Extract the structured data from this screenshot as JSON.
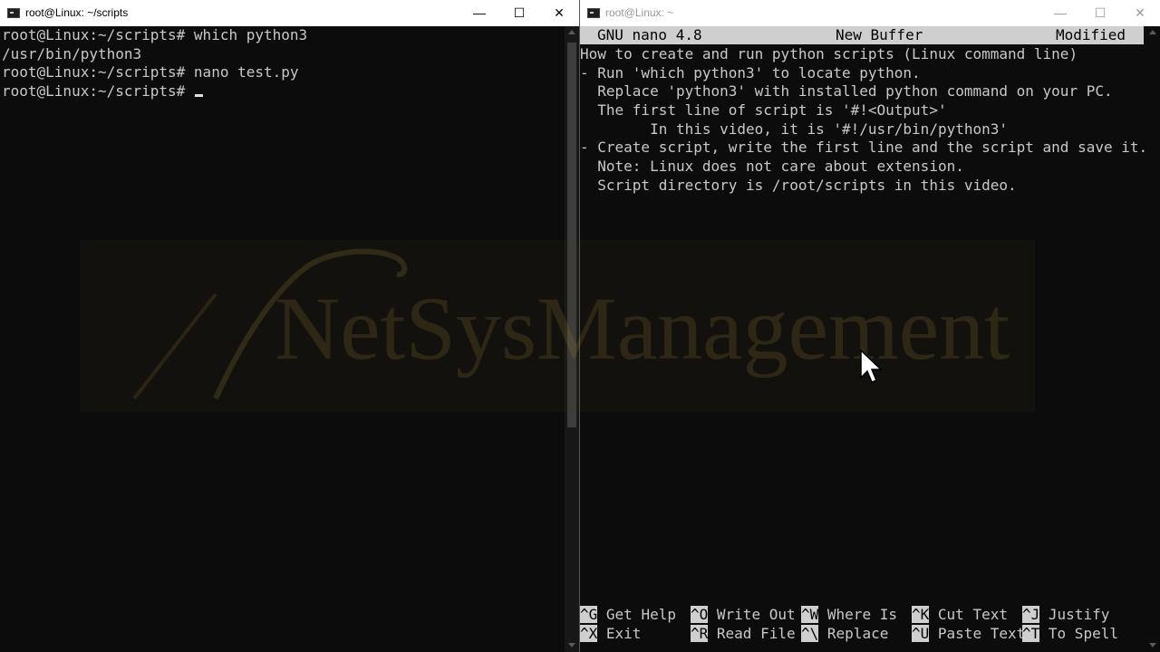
{
  "left_window": {
    "title": "root@Linux: ~/scripts",
    "controls": {
      "minimize": "—",
      "maximize": "☐",
      "close": "✕"
    },
    "lines": [
      "root@Linux:~/scripts# which python3",
      "/usr/bin/python3",
      "root@Linux:~/scripts# nano test.py",
      "root@Linux:~/scripts# "
    ]
  },
  "right_window": {
    "title": "root@Linux: ~",
    "controls": {
      "minimize": "—",
      "maximize": "☐",
      "close": "✕"
    },
    "nano_header": {
      "version": "GNU nano 4.8",
      "buffer": "New Buffer",
      "status": "Modified"
    },
    "lines": [
      "How to create and run python scripts (Linux command line)",
      "- Run 'which python3' to locate python.",
      "  Replace 'python3' with installed python command on your PC.",
      "  The first line of script is '#!<Output>'",
      "        In this video, it is '#!/usr/bin/python3'",
      "- Create script, write the first line and the script and save it.",
      "  Note: Linux does not care about extension.",
      "  Script directory is /root/scripts in this video."
    ],
    "shortcuts": [
      {
        "key": "^G",
        "label": "Get Help"
      },
      {
        "key": "^O",
        "label": "Write Out"
      },
      {
        "key": "^W",
        "label": "Where Is"
      },
      {
        "key": "^K",
        "label": "Cut Text"
      },
      {
        "key": "^J",
        "label": "Justify"
      },
      {
        "key": "^X",
        "label": "Exit"
      },
      {
        "key": "^R",
        "label": "Read File"
      },
      {
        "key": "^\\",
        "label": "Replace"
      },
      {
        "key": "^U",
        "label": "Paste Text"
      },
      {
        "key": "^T",
        "label": "To Spell"
      }
    ]
  },
  "watermark": {
    "text": "NetSysManagement"
  },
  "icons": {
    "console": "console-window-icon",
    "pointer": "mouse-pointer-icon"
  }
}
